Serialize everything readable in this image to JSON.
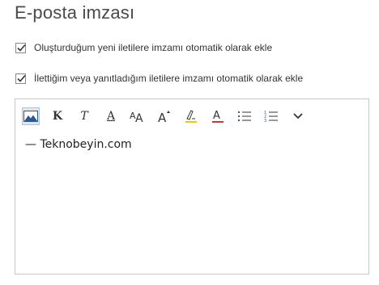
{
  "page": {
    "title": "E-posta imzası"
  },
  "options": [
    {
      "label": "Oluşturduğum yeni iletilere imzamı otomatik olarak ekle",
      "checked": true
    },
    {
      "label": "İlettiğim veya yanıtladığım iletilere imzamı otomatik olarak ekle",
      "checked": true
    }
  ],
  "toolbar": {
    "buttons": [
      {
        "name": "insert-image",
        "icon": "image-icon"
      },
      {
        "name": "bold",
        "glyph": "K"
      },
      {
        "name": "italic",
        "glyph": "T"
      },
      {
        "name": "underline",
        "glyph": "A"
      },
      {
        "name": "font-size",
        "icon": "font-size-icon",
        "glyph": "AA"
      },
      {
        "name": "grow-font",
        "icon": "grow-font-icon",
        "glyph": "A"
      },
      {
        "name": "highlight",
        "icon": "highlight-icon",
        "color": "#f2c500"
      },
      {
        "name": "font-color",
        "icon": "font-color-icon",
        "color": "#d13438"
      },
      {
        "name": "bullets",
        "icon": "bullet-list-icon"
      },
      {
        "name": "numbering",
        "icon": "numbered-list-icon"
      },
      {
        "name": "more",
        "icon": "chevron-down-icon"
      }
    ]
  },
  "editor": {
    "content": "— Teknobeyin.com"
  },
  "colors": {
    "accent": "#2b579a",
    "checkmark": "#333333",
    "border": "#c8c8c8"
  }
}
